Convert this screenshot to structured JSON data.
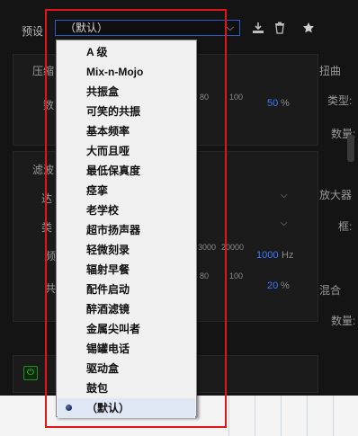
{
  "preset": {
    "label": "预设",
    "selected_value": "（默认）",
    "chevron": "⌵"
  },
  "toolbar": {
    "icons": [
      "download-icon",
      "trash-icon",
      "star-icon"
    ]
  },
  "background": {
    "compressor_label": "压缩",
    "distortion_label": "扭曲",
    "type_label": "类型:",
    "amount_label": "数量:",
    "filter_label": "滤波",
    "amp_label": "放大器",
    "frame_label": "框:",
    "mix_label": "混合",
    "mix_amount_label": "数量:",
    "tick_80_a": "80",
    "tick_100_a": "100",
    "value_50": "50",
    "unit_pct_a": "%",
    "tick_3000": "3000",
    "tick_20000": "20000",
    "value_1000": "1000",
    "unit_hz": "Hz",
    "tick_80_b": "80",
    "tick_100_b": "100",
    "value_20": "20",
    "unit_pct_b": "%",
    "partial_number": "数",
    "partial_freq": "频",
    "partial_co": "共",
    "partial_ta": "达",
    "partial_lei": "类"
  },
  "menu": {
    "items": [
      {
        "label": "A 级"
      },
      {
        "label": "Mix-n-Mojo"
      },
      {
        "label": "共振盒"
      },
      {
        "label": "可笑的共振"
      },
      {
        "label": "基本频率"
      },
      {
        "label": "大而且哑"
      },
      {
        "label": "最低保真度"
      },
      {
        "label": "痉挛"
      },
      {
        "label": "老学校"
      },
      {
        "label": "超市扬声器"
      },
      {
        "label": "轻微刻录"
      },
      {
        "label": "辐射早餐"
      },
      {
        "label": "配件启动"
      },
      {
        "label": "醉酒滤镜"
      },
      {
        "label": "金属尖叫者"
      },
      {
        "label": "锡罐电话"
      },
      {
        "label": "驱动盒"
      },
      {
        "label": "鼓包"
      },
      {
        "label": "（默认）",
        "selected": true
      }
    ]
  },
  "colors": {
    "highlight": "#e01515",
    "accent_blue": "#3c78ff",
    "power_green": "#3ccc3c"
  }
}
